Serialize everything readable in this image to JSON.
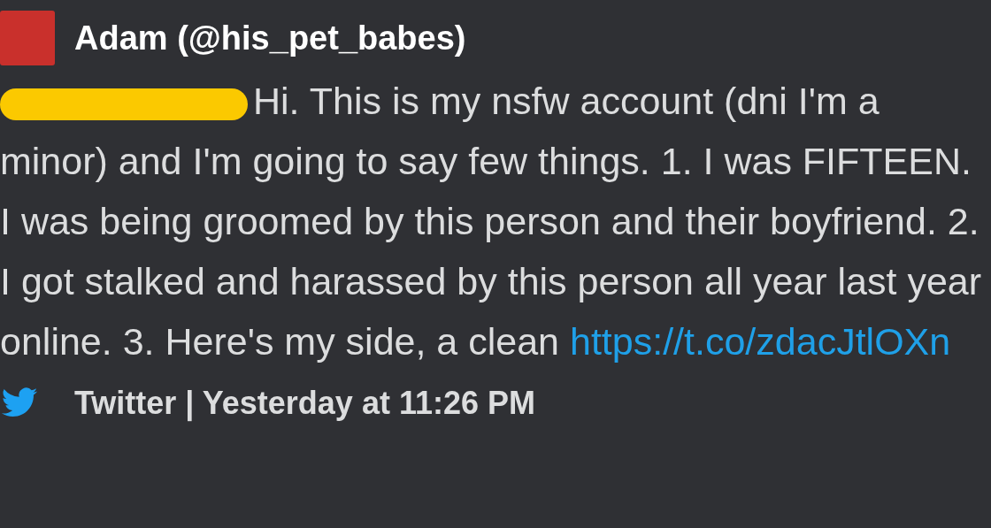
{
  "embed": {
    "author": "Adam (@his_pet_babes)",
    "mention_redacted": true,
    "text": "Hi. This is my nsfw account (dni I'm a minor) and I'm going to say few things. 1. I was FIFTEEN. I was being groomed by this person and their boyfriend. 2. I got stalked and harassed by this person all year last year online. 3. Here's my side, a clean",
    "link": "https://t.co/zdacJtlOXn",
    "footer": "Twitter | Yesterday at 11:26 PM"
  }
}
